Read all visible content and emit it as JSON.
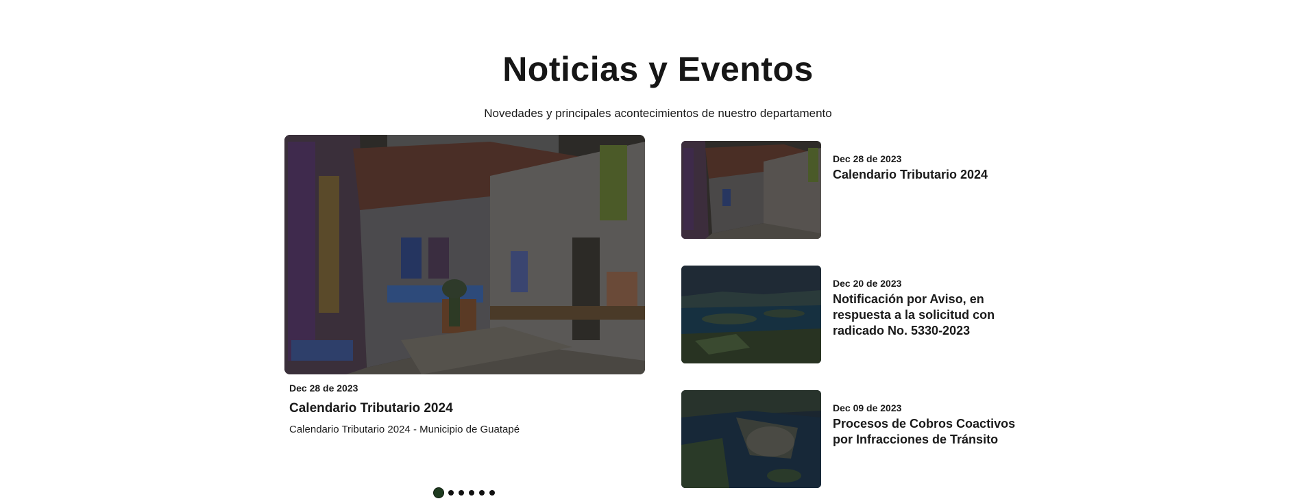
{
  "section": {
    "title": "Noticias y Eventos",
    "subtitle": "Novedades y principales acontecimientos de nuestro departamento"
  },
  "featured": {
    "date": "Dec 28 de 2023",
    "title": "Calendario Tributario 2024",
    "description": "Calendario Tributario 2024 - Municipio de Guatapé"
  },
  "carousel": {
    "total_slides": 6,
    "active_index": 0
  },
  "news": [
    {
      "date": "Dec 28 de 2023",
      "title": "Calendario Tributario 2024"
    },
    {
      "date": "Dec 20 de 2023",
      "title": "Notificación por Aviso, en respuesta a la solicitud con radicado No. 5330-2023"
    },
    {
      "date": "Dec 09 de 2023",
      "title": "Procesos de Cobros Coactivos por Infracciones de Tránsito"
    }
  ],
  "colors": {
    "active_dot": "#1e3a1f",
    "text": "#1a1a1a"
  }
}
